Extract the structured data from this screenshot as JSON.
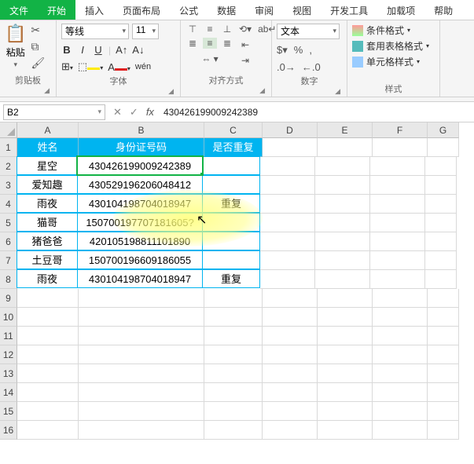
{
  "menu": {
    "file": "文件",
    "tabs": [
      "开始",
      "插入",
      "页面布局",
      "公式",
      "数据",
      "审阅",
      "视图",
      "开发工具",
      "加载项",
      "帮助"
    ],
    "active": "开始"
  },
  "ribbon": {
    "clipboard": {
      "label": "剪贴板",
      "paste": "粘贴"
    },
    "font": {
      "label": "字体",
      "family": "等线",
      "size": "11",
      "bold": "B",
      "italic": "I",
      "underline": "U"
    },
    "align": {
      "label": "对齐方式"
    },
    "number": {
      "label": "数字",
      "format": "文本"
    },
    "styles": {
      "label": "样式",
      "cond": "条件格式",
      "table": "套用表格格式",
      "cell": "单元格样式"
    }
  },
  "namebox": "B2",
  "formula": "430426199009242389",
  "columns": [
    "A",
    "B",
    "C",
    "D",
    "E",
    "F",
    "G"
  ],
  "rows": [
    "1",
    "2",
    "3",
    "4",
    "5",
    "6",
    "7",
    "8",
    "9",
    "10",
    "11",
    "12",
    "13",
    "14",
    "15",
    "16"
  ],
  "header": {
    "a": "姓名",
    "b": "身份证号码",
    "c": "是否重复"
  },
  "data": [
    {
      "a": "星空",
      "b": "430426199009242389",
      "c": ""
    },
    {
      "a": "爱知趣",
      "b": "430529196206048412",
      "c": ""
    },
    {
      "a": "雨夜",
      "b": "430104198704018947",
      "c": "重复"
    },
    {
      "a": "猫哥",
      "b": "150700197707181605?",
      "c": ""
    },
    {
      "a": "猪爸爸",
      "b": "420105198811101890",
      "c": ""
    },
    {
      "a": "土豆哥",
      "b": "150700196609186055",
      "c": ""
    },
    {
      "a": "雨夜",
      "b": "430104198704018947",
      "c": "重复"
    }
  ]
}
